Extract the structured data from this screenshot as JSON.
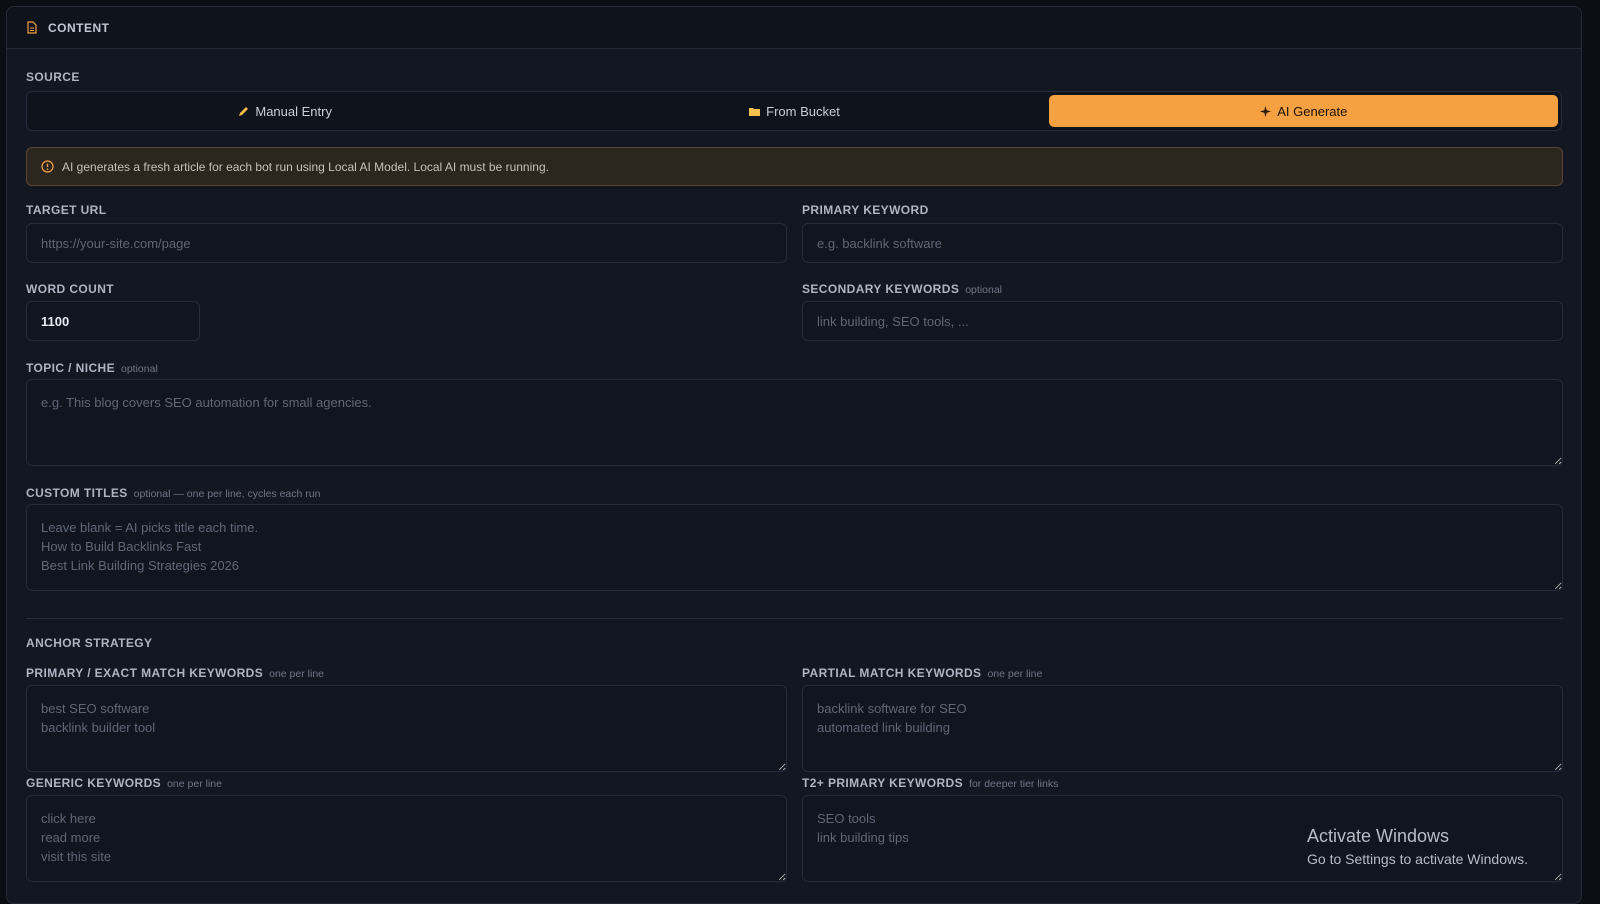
{
  "header": {
    "title": "CONTENT",
    "icon": "document-icon"
  },
  "source": {
    "label": "SOURCE",
    "options": [
      {
        "label": "Manual Entry",
        "icon": "pencil-icon",
        "active": false
      },
      {
        "label": "From Bucket",
        "icon": "folder-icon",
        "active": false
      },
      {
        "label": "AI Generate",
        "icon": "sparkle-icon",
        "active": true
      }
    ]
  },
  "notice": {
    "text": "AI generates a fresh article for each bot run using Local AI Model. Local AI must be running.",
    "icon": "info-circle-icon"
  },
  "target_url": {
    "label": "TARGET URL",
    "placeholder": "https://your-site.com/page"
  },
  "primary_keyword": {
    "label": "PRIMARY KEYWORD",
    "placeholder": "e.g. backlink software"
  },
  "word_count": {
    "label": "WORD COUNT",
    "value": "1100"
  },
  "secondary_keywords": {
    "label": "SECONDARY KEYWORDS",
    "hint": "optional",
    "placeholder": "link building, SEO tools, ..."
  },
  "topic": {
    "label": "TOPIC / NICHE",
    "hint": "optional",
    "placeholder": "e.g. This blog covers SEO automation for small agencies."
  },
  "custom_titles": {
    "label": "CUSTOM TITLES",
    "hint": "optional — one per line, cycles each run",
    "placeholder": "Leave blank = AI picks title each time.\nHow to Build Backlinks Fast\nBest Link Building Strategies 2026"
  },
  "anchor": {
    "title": "ANCHOR STRATEGY",
    "primary": {
      "label": "PRIMARY / EXACT MATCH KEYWORDS",
      "hint": "one per line",
      "placeholder": "best SEO software\nbacklink builder tool"
    },
    "partial": {
      "label": "PARTIAL MATCH KEYWORDS",
      "hint": "one per line",
      "placeholder": "backlink software for SEO\nautomated link building"
    },
    "generic": {
      "label": "GENERIC KEYWORDS",
      "hint": "one per line",
      "placeholder": "click here\nread more\nvisit this site"
    },
    "t2": {
      "label": "T2+ PRIMARY KEYWORDS",
      "hint": "for deeper tier links",
      "placeholder": "SEO tools\nlink building tips"
    }
  },
  "watermark": {
    "line1": "Activate Windows",
    "line2": "Go to Settings to activate Windows."
  },
  "colors": {
    "accent": "#f5a142",
    "background": "#121722",
    "notice_bg": "#2c261f"
  }
}
